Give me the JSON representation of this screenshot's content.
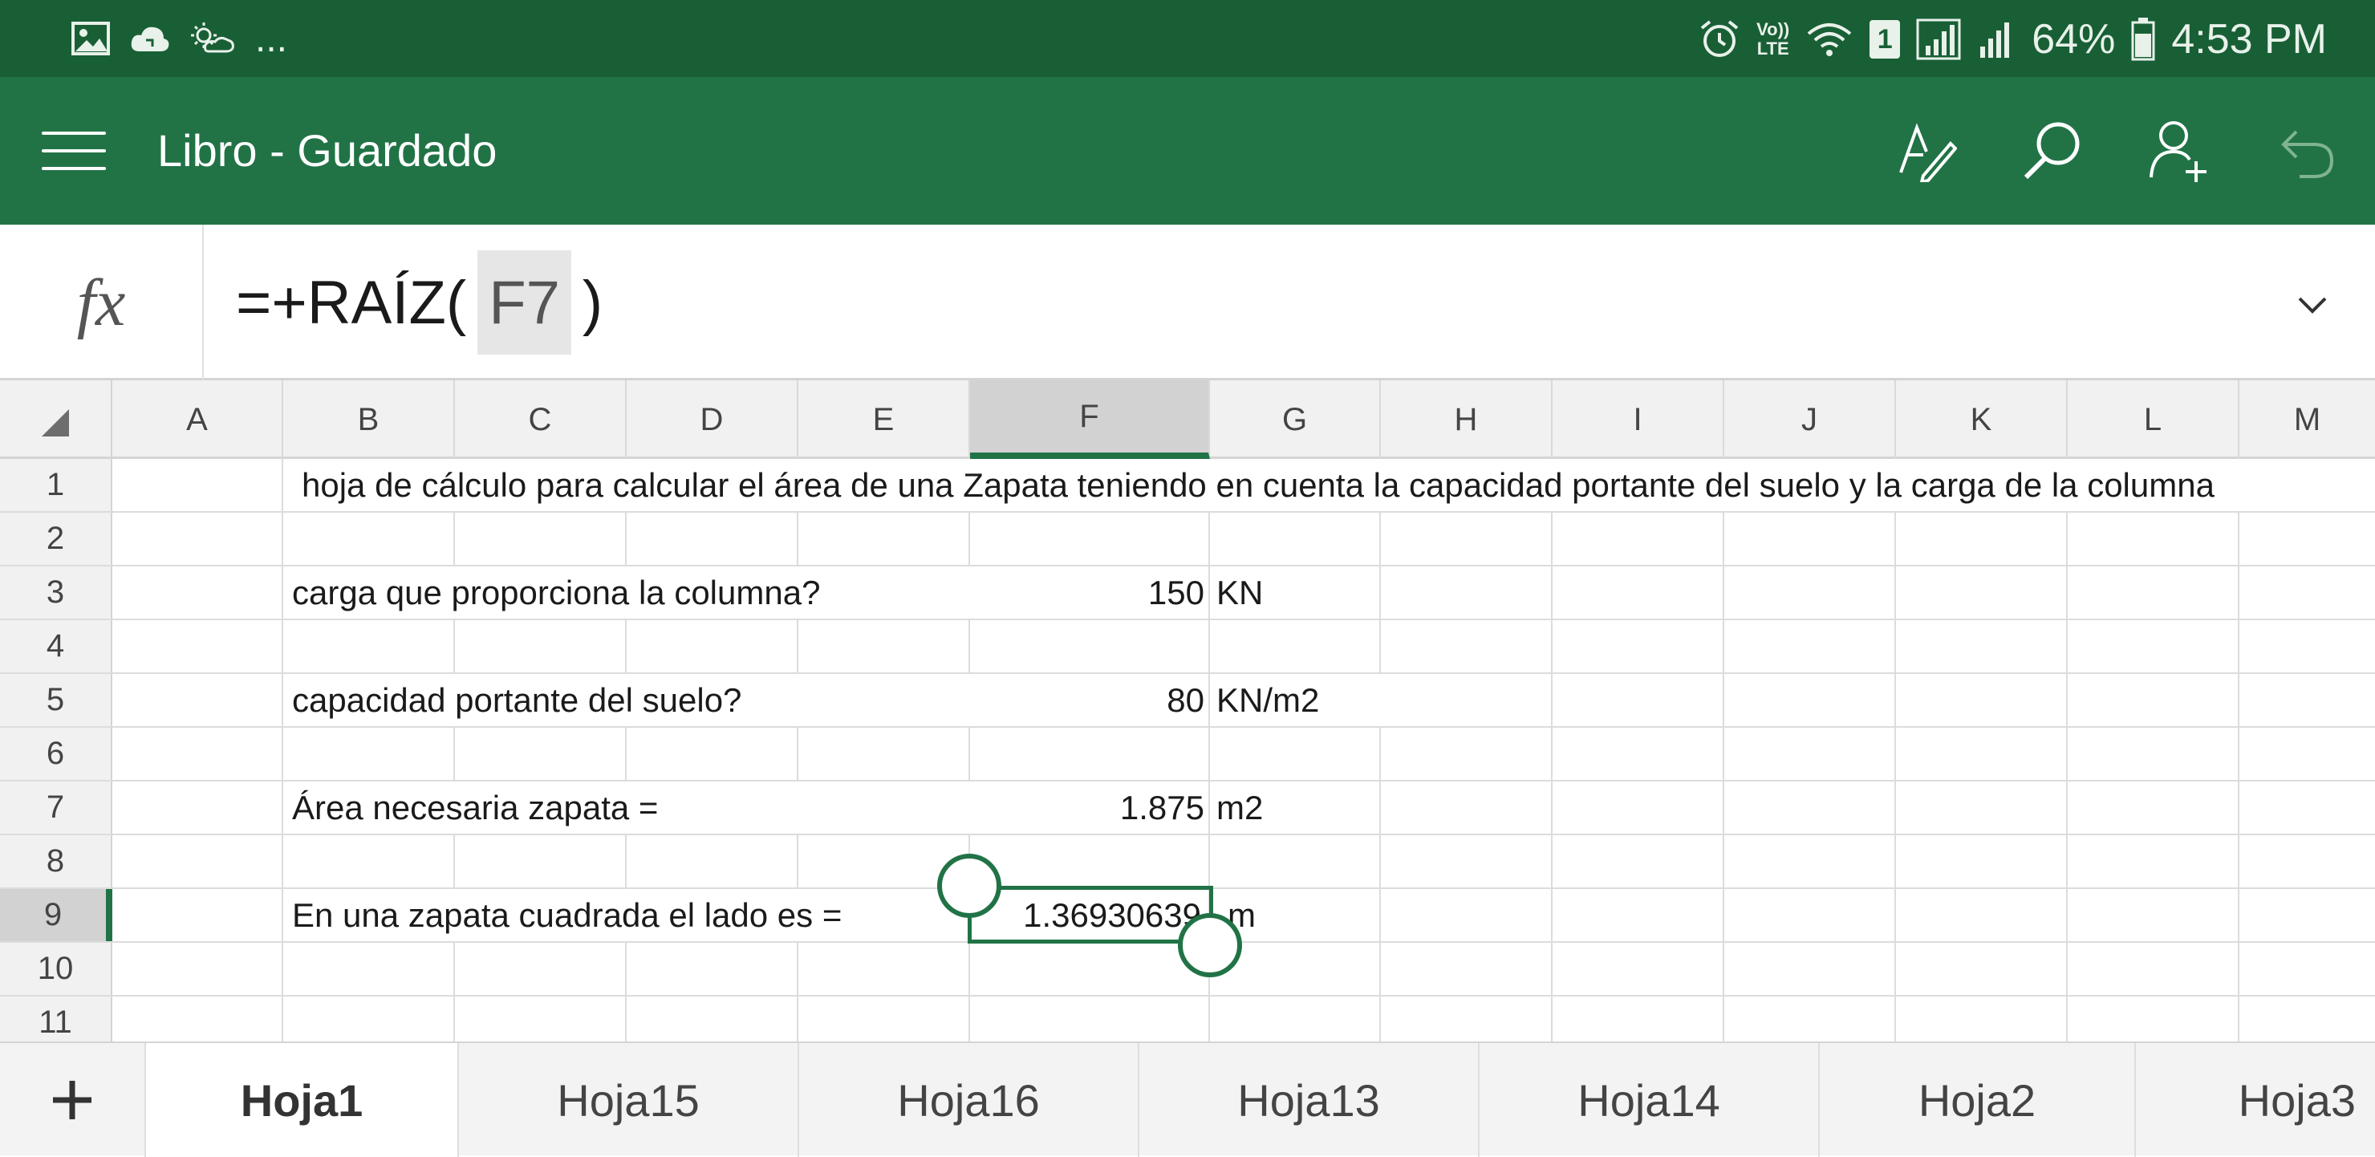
{
  "status_bar": {
    "left_icons": [
      "gallery-icon",
      "cloud-sync-icon",
      "weather-icon"
    ],
    "more": "...",
    "network_label_top": "Vo))",
    "network_label_bottom": "LTE",
    "sim_badge": "1",
    "battery_percent": "64%",
    "time": "4:53 PM"
  },
  "app_bar": {
    "title": "Libro - Guardado",
    "actions": [
      "draw-icon",
      "search-icon",
      "share-person-icon",
      "undo-icon"
    ]
  },
  "formula_bar": {
    "fx_label": "fx",
    "formula_prefix": "=+RAÍZ(",
    "formula_ref": "F7",
    "formula_suffix": ")"
  },
  "grid": {
    "columns": [
      "A",
      "B",
      "C",
      "D",
      "E",
      "F",
      "G",
      "H",
      "I",
      "J",
      "K",
      "L",
      "M"
    ],
    "selected_column": "F",
    "rows": [
      "1",
      "2",
      "3",
      "4",
      "5",
      "6",
      "7",
      "8",
      "9",
      "10",
      "11"
    ],
    "selected_row": "9",
    "cells": {
      "B1": "hoja de cálculo para calcular el área de una Zapata teniendo en cuenta la capacidad portante del suelo y la carga de la columna",
      "B3": "carga que proporciona la columna?",
      "F3": "150",
      "G3": "KN",
      "B5": "capacidad portante del suelo?",
      "F5": "80",
      "G5": "KN/m2",
      "B7": "Área necesaria zapata =",
      "F7": "1.875",
      "G7": "m2",
      "B9": "En una zapata cuadrada el lado es =",
      "F9": "1.36930639",
      "G9": "m"
    }
  },
  "sheets": {
    "add_label": "+",
    "tabs": [
      "Hoja1",
      "Hoja15",
      "Hoja16",
      "Hoja13",
      "Hoja14",
      "Hoja2",
      "Hoja3"
    ],
    "active": "Hoja1"
  }
}
